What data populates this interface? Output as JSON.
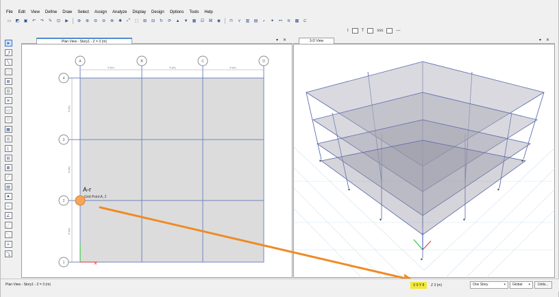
{
  "menu": [
    "File",
    "Edit",
    "View",
    "Define",
    "Draw",
    "Select",
    "Assign",
    "Analyze",
    "Display",
    "Design",
    "Options",
    "Tools",
    "Help"
  ],
  "toolbar_second": {
    "i_label": "I",
    "t_label": "T",
    "sss_label": "sss"
  },
  "tabs": {
    "plan": "Plan View - Story1 - Z = 3 (m)",
    "view3d": "3-D View",
    "close_glyph": "✕",
    "dropdown_glyph": "▾"
  },
  "plan": {
    "grid_cols": [
      "A",
      "B",
      "C",
      "D"
    ],
    "grid_rows": [
      "4",
      "3",
      "2",
      "1"
    ],
    "span_x_label": "8 (m)",
    "span_y_label": "8 (m)",
    "point_label": "A-r",
    "tooltip": "Grid Point A, 2"
  },
  "status": {
    "view_text": "Plan View - Story1 - Z = 3 (m)",
    "xy_text": "X 0  Y 8",
    "z_text": "Z 3 (m)",
    "story_mode": "One Story",
    "coord_system": "Global",
    "units_button": "Units..."
  },
  "colors": {
    "grid_line": "#6f86c4",
    "slab_fill": "#dcdcdc",
    "arrow": "#f08a24",
    "highlight": "#f2e836",
    "tab_accent": "#4d8ad1"
  }
}
